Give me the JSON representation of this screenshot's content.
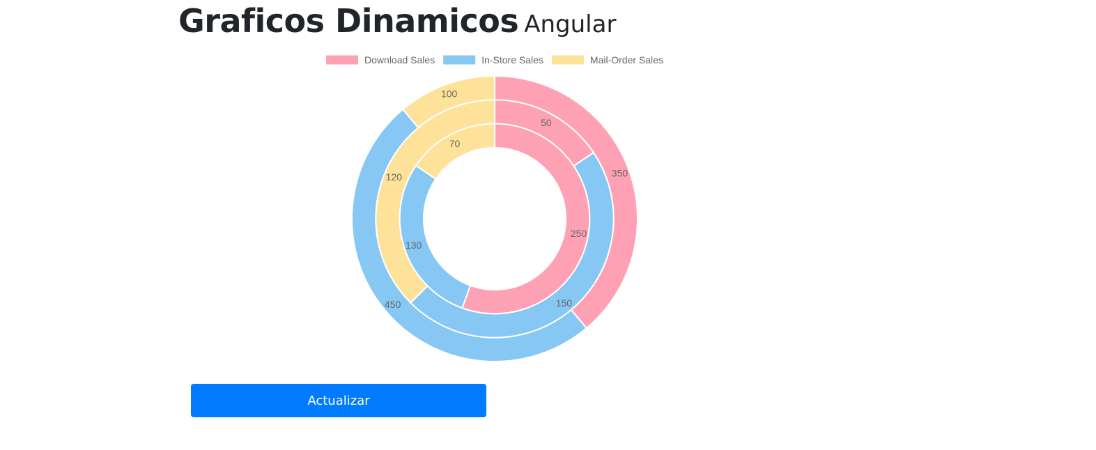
{
  "header": {
    "title": "Graficos Dinamicos",
    "subtitle": "Angular"
  },
  "button": {
    "label": "Actualizar"
  },
  "chart_data": {
    "type": "doughnut",
    "legend_position": "top",
    "categories": [
      "Download Sales",
      "In-Store Sales",
      "Mail-Order Sales"
    ],
    "colors": [
      "#ffa1b5",
      "#86c7f3",
      "#ffe29a"
    ],
    "series": [
      {
        "values": [
          350,
          450,
          100
        ]
      },
      {
        "values": [
          50,
          150,
          120
        ]
      },
      {
        "values": [
          250,
          130,
          70
        ]
      }
    ]
  }
}
